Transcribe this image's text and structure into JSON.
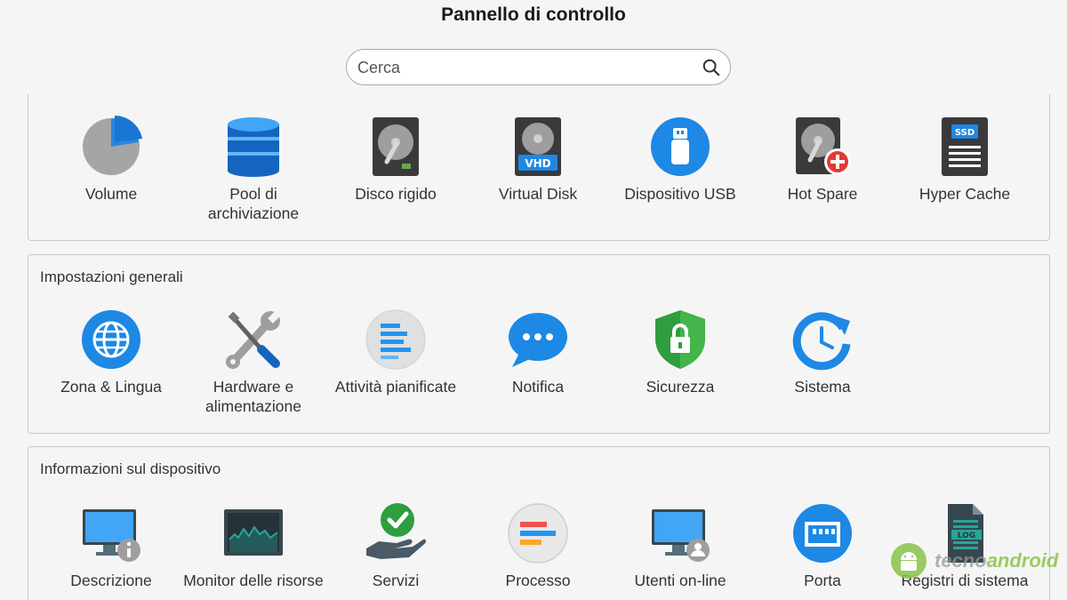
{
  "header": {
    "title": "Pannello di controllo"
  },
  "search": {
    "placeholder": "Cerca"
  },
  "storage": {
    "items": [
      {
        "label": "Volume",
        "icon": "volume-pie-icon"
      },
      {
        "label": "Pool di archiviazione",
        "icon": "database-icon"
      },
      {
        "label": "Disco rigido",
        "icon": "hard-disk-icon"
      },
      {
        "label": "Virtual Disk",
        "icon": "vhd-disk-icon"
      },
      {
        "label": "Dispositivo USB",
        "icon": "usb-icon"
      },
      {
        "label": "Hot Spare",
        "icon": "hot-spare-disk-icon"
      },
      {
        "label": "Hyper Cache",
        "icon": "ssd-icon"
      }
    ]
  },
  "general": {
    "title": "Impostazioni generali",
    "items": [
      {
        "label": "Zona & Lingua",
        "icon": "globe-icon"
      },
      {
        "label": "Hardware e alimentazione",
        "icon": "tools-icon"
      },
      {
        "label": "Attività pianificate",
        "icon": "tasks-icon"
      },
      {
        "label": "Notifica",
        "icon": "chat-bubble-icon"
      },
      {
        "label": "Sicurezza",
        "icon": "shield-lock-icon"
      },
      {
        "label": "Sistema",
        "icon": "clock-refresh-icon"
      }
    ]
  },
  "device": {
    "title": "Informazioni sul dispositivo",
    "items": [
      {
        "label": "Descrizione",
        "icon": "monitor-info-icon"
      },
      {
        "label": "Monitor delle risorse",
        "icon": "resource-monitor-icon"
      },
      {
        "label": "Servizi",
        "icon": "hand-check-icon"
      },
      {
        "label": "Processo",
        "icon": "process-icon"
      },
      {
        "label": "Utenti on-line",
        "icon": "monitor-user-icon"
      },
      {
        "label": "Porta",
        "icon": "ethernet-port-icon"
      },
      {
        "label": "Registri di sistema",
        "icon": "log-file-icon"
      }
    ]
  },
  "watermark": {
    "part1": "tecno",
    "part2": "android"
  },
  "colors": {
    "accent_blue": "#1e88e5",
    "green": "#2e9e3f",
    "red": "#e53935",
    "watermark_green": "#8bc34a"
  }
}
